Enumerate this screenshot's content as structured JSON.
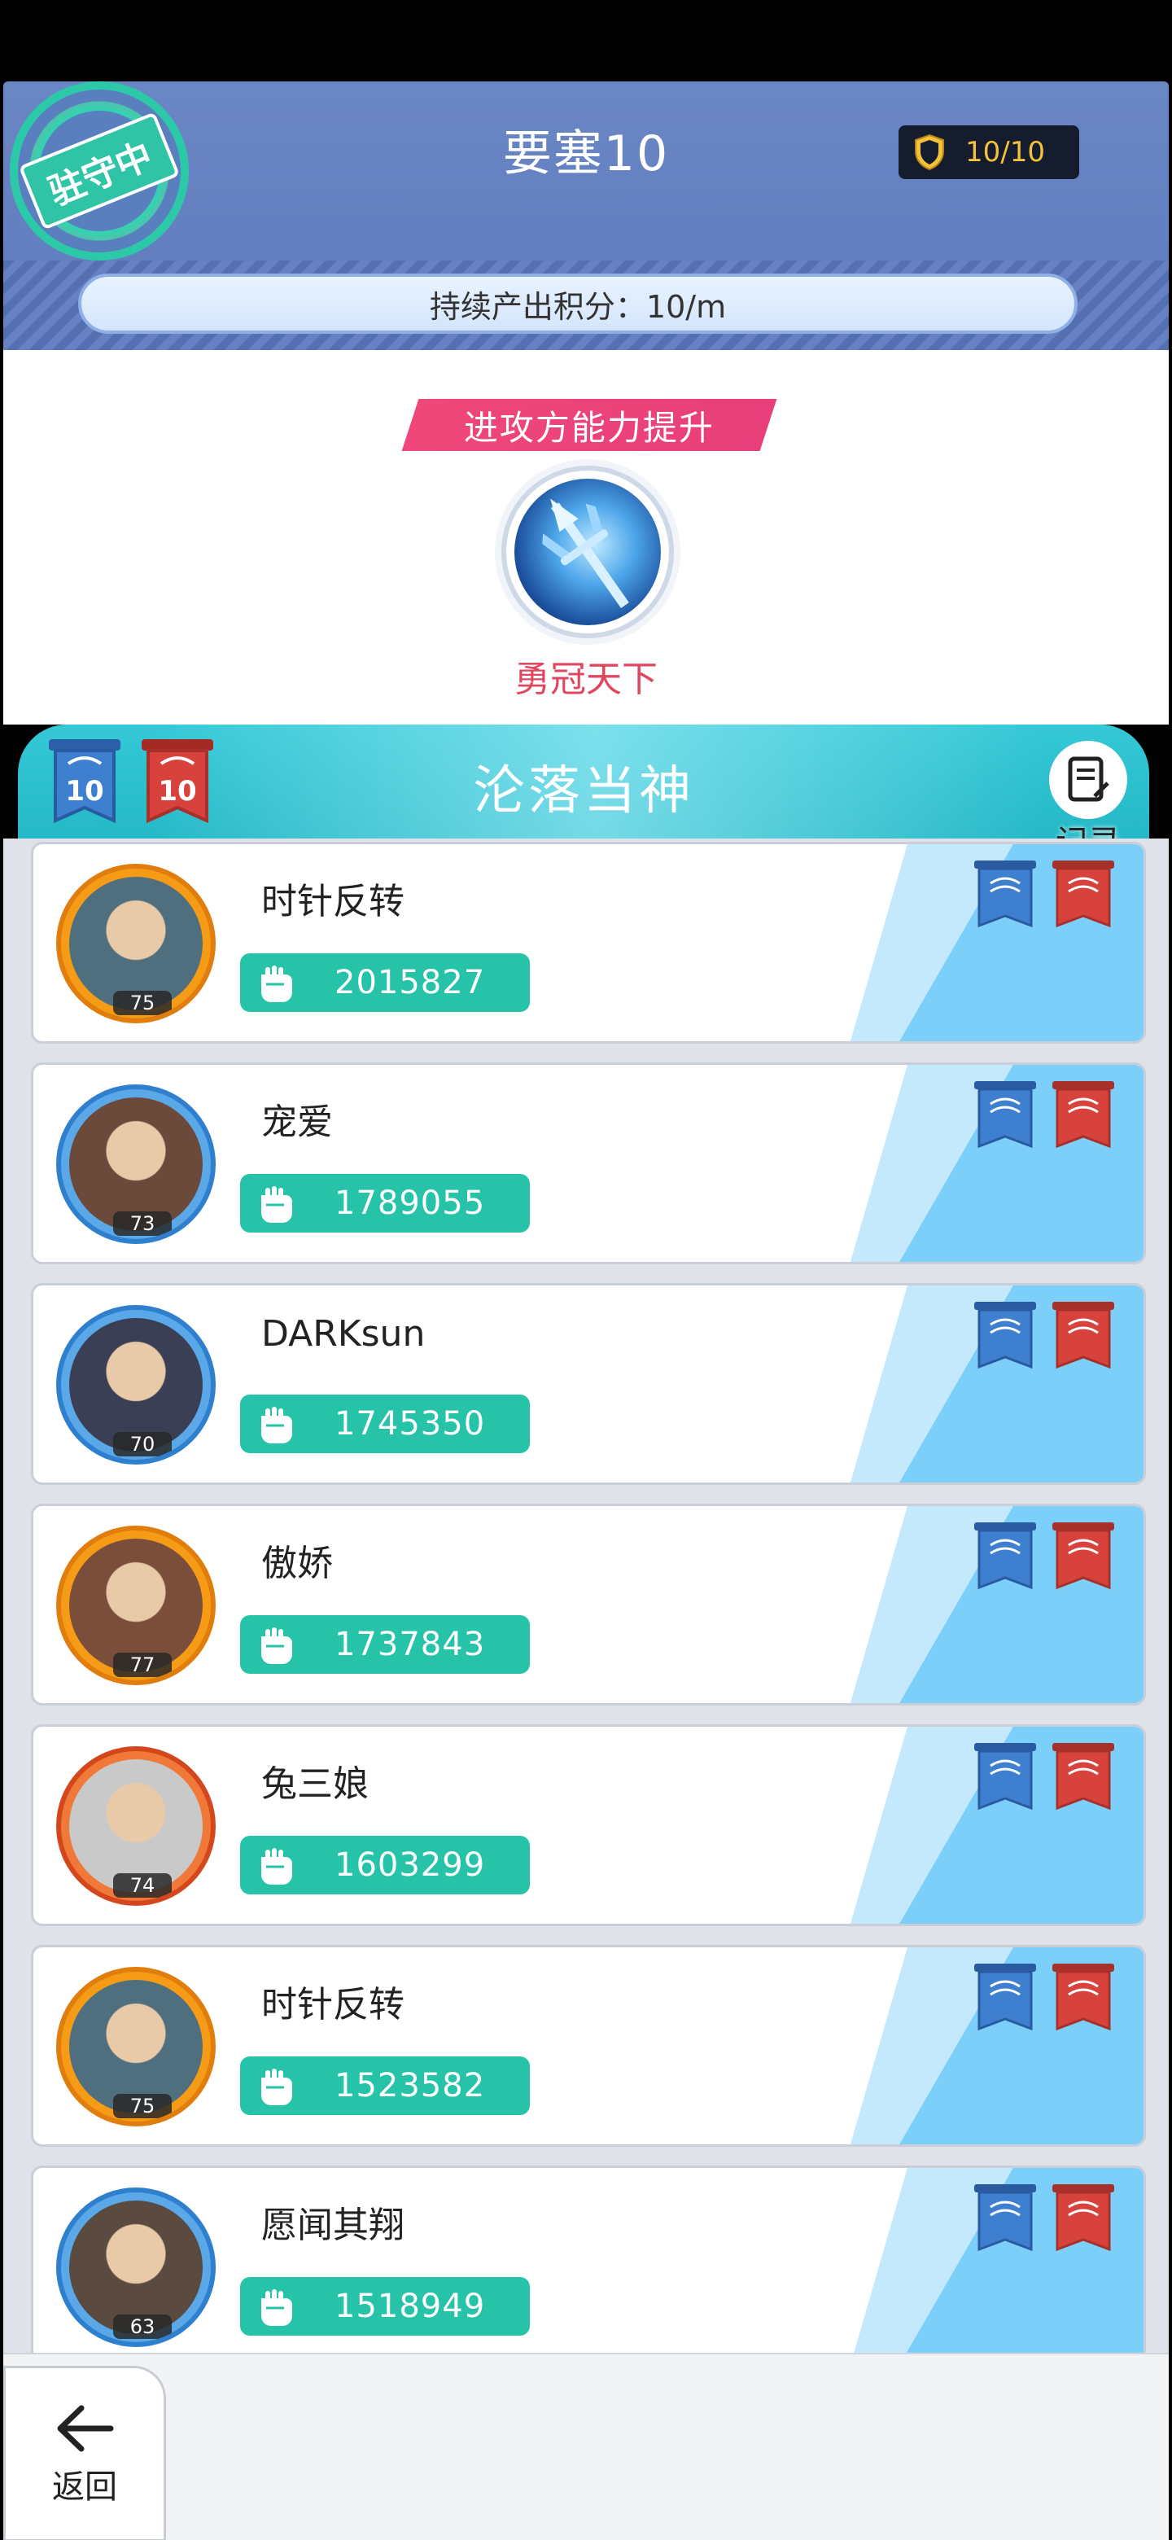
{
  "header": {
    "title": "要塞10",
    "garrison_stamp": "驻守中",
    "shield_count": "10/10",
    "points_label": "持续产出积分：10/m"
  },
  "buff": {
    "tag": "进攻方能力提升",
    "name": "勇冠天下",
    "icon": "trident-icon"
  },
  "team": {
    "name": "沦落当神",
    "blue_flag_count": "10",
    "red_flag_count": "10",
    "record_label": "记录"
  },
  "players": [
    {
      "name": "时针反转",
      "power": "2015827",
      "level": "75",
      "frame": "orange"
    },
    {
      "name": "宠爱",
      "power": "1789055",
      "level": "73",
      "frame": "blue"
    },
    {
      "name": "DARKsun",
      "power": "1745350",
      "level": "70",
      "frame": "blue"
    },
    {
      "name": "傲娇",
      "power": "1737843",
      "level": "77",
      "frame": "orange"
    },
    {
      "name": "兔三娘",
      "power": "1603299",
      "level": "74",
      "frame": "red"
    },
    {
      "name": "时针反转",
      "power": "1523582",
      "level": "75",
      "frame": "orange"
    },
    {
      "name": "愿闻其翔",
      "power": "1518949",
      "level": "63",
      "frame": "blue"
    }
  ],
  "nav": {
    "back_label": "返回"
  },
  "colors": {
    "header_bg": "#6b86c4",
    "accent_teal": "#27c3a9",
    "buff_pink": "#f0477a",
    "blue_flag": "#3f7fd0",
    "red_flag": "#d8423c"
  }
}
